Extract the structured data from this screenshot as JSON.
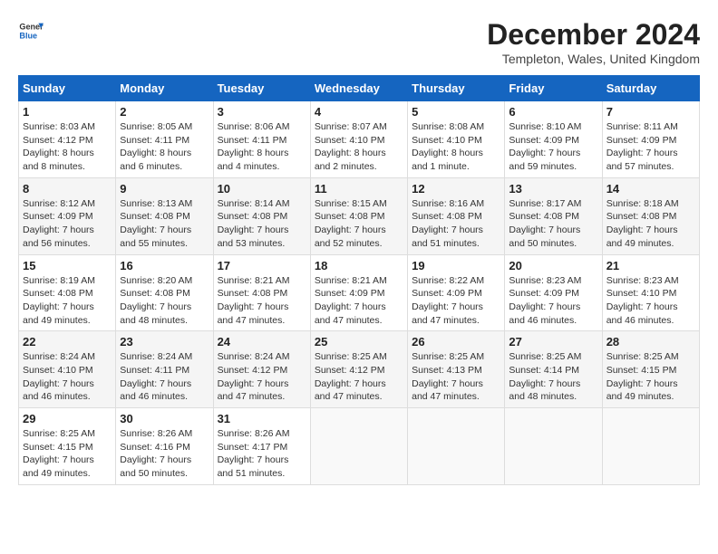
{
  "logo": {
    "line1": "General",
    "line2": "Blue"
  },
  "title": "December 2024",
  "subtitle": "Templeton, Wales, United Kingdom",
  "headers": [
    "Sunday",
    "Monday",
    "Tuesday",
    "Wednesday",
    "Thursday",
    "Friday",
    "Saturday"
  ],
  "weeks": [
    [
      {
        "day": "1",
        "sunrise": "8:03 AM",
        "sunset": "4:12 PM",
        "daylight": "8 hours and 8 minutes."
      },
      {
        "day": "2",
        "sunrise": "8:05 AM",
        "sunset": "4:11 PM",
        "daylight": "8 hours and 6 minutes."
      },
      {
        "day": "3",
        "sunrise": "8:06 AM",
        "sunset": "4:11 PM",
        "daylight": "8 hours and 4 minutes."
      },
      {
        "day": "4",
        "sunrise": "8:07 AM",
        "sunset": "4:10 PM",
        "daylight": "8 hours and 2 minutes."
      },
      {
        "day": "5",
        "sunrise": "8:08 AM",
        "sunset": "4:10 PM",
        "daylight": "8 hours and 1 minute."
      },
      {
        "day": "6",
        "sunrise": "8:10 AM",
        "sunset": "4:09 PM",
        "daylight": "7 hours and 59 minutes."
      },
      {
        "day": "7",
        "sunrise": "8:11 AM",
        "sunset": "4:09 PM",
        "daylight": "7 hours and 57 minutes."
      }
    ],
    [
      {
        "day": "8",
        "sunrise": "8:12 AM",
        "sunset": "4:09 PM",
        "daylight": "7 hours and 56 minutes."
      },
      {
        "day": "9",
        "sunrise": "8:13 AM",
        "sunset": "4:08 PM",
        "daylight": "7 hours and 55 minutes."
      },
      {
        "day": "10",
        "sunrise": "8:14 AM",
        "sunset": "4:08 PM",
        "daylight": "7 hours and 53 minutes."
      },
      {
        "day": "11",
        "sunrise": "8:15 AM",
        "sunset": "4:08 PM",
        "daylight": "7 hours and 52 minutes."
      },
      {
        "day": "12",
        "sunrise": "8:16 AM",
        "sunset": "4:08 PM",
        "daylight": "7 hours and 51 minutes."
      },
      {
        "day": "13",
        "sunrise": "8:17 AM",
        "sunset": "4:08 PM",
        "daylight": "7 hours and 50 minutes."
      },
      {
        "day": "14",
        "sunrise": "8:18 AM",
        "sunset": "4:08 PM",
        "daylight": "7 hours and 49 minutes."
      }
    ],
    [
      {
        "day": "15",
        "sunrise": "8:19 AM",
        "sunset": "4:08 PM",
        "daylight": "7 hours and 49 minutes."
      },
      {
        "day": "16",
        "sunrise": "8:20 AM",
        "sunset": "4:08 PM",
        "daylight": "7 hours and 48 minutes."
      },
      {
        "day": "17",
        "sunrise": "8:21 AM",
        "sunset": "4:08 PM",
        "daylight": "7 hours and 47 minutes."
      },
      {
        "day": "18",
        "sunrise": "8:21 AM",
        "sunset": "4:09 PM",
        "daylight": "7 hours and 47 minutes."
      },
      {
        "day": "19",
        "sunrise": "8:22 AM",
        "sunset": "4:09 PM",
        "daylight": "7 hours and 47 minutes."
      },
      {
        "day": "20",
        "sunrise": "8:23 AM",
        "sunset": "4:09 PM",
        "daylight": "7 hours and 46 minutes."
      },
      {
        "day": "21",
        "sunrise": "8:23 AM",
        "sunset": "4:10 PM",
        "daylight": "7 hours and 46 minutes."
      }
    ],
    [
      {
        "day": "22",
        "sunrise": "8:24 AM",
        "sunset": "4:10 PM",
        "daylight": "7 hours and 46 minutes."
      },
      {
        "day": "23",
        "sunrise": "8:24 AM",
        "sunset": "4:11 PM",
        "daylight": "7 hours and 46 minutes."
      },
      {
        "day": "24",
        "sunrise": "8:24 AM",
        "sunset": "4:12 PM",
        "daylight": "7 hours and 47 minutes."
      },
      {
        "day": "25",
        "sunrise": "8:25 AM",
        "sunset": "4:12 PM",
        "daylight": "7 hours and 47 minutes."
      },
      {
        "day": "26",
        "sunrise": "8:25 AM",
        "sunset": "4:13 PM",
        "daylight": "7 hours and 47 minutes."
      },
      {
        "day": "27",
        "sunrise": "8:25 AM",
        "sunset": "4:14 PM",
        "daylight": "7 hours and 48 minutes."
      },
      {
        "day": "28",
        "sunrise": "8:25 AM",
        "sunset": "4:15 PM",
        "daylight": "7 hours and 49 minutes."
      }
    ],
    [
      {
        "day": "29",
        "sunrise": "8:25 AM",
        "sunset": "4:15 PM",
        "daylight": "7 hours and 49 minutes."
      },
      {
        "day": "30",
        "sunrise": "8:26 AM",
        "sunset": "4:16 PM",
        "daylight": "7 hours and 50 minutes."
      },
      {
        "day": "31",
        "sunrise": "8:26 AM",
        "sunset": "4:17 PM",
        "daylight": "7 hours and 51 minutes."
      },
      null,
      null,
      null,
      null
    ]
  ]
}
